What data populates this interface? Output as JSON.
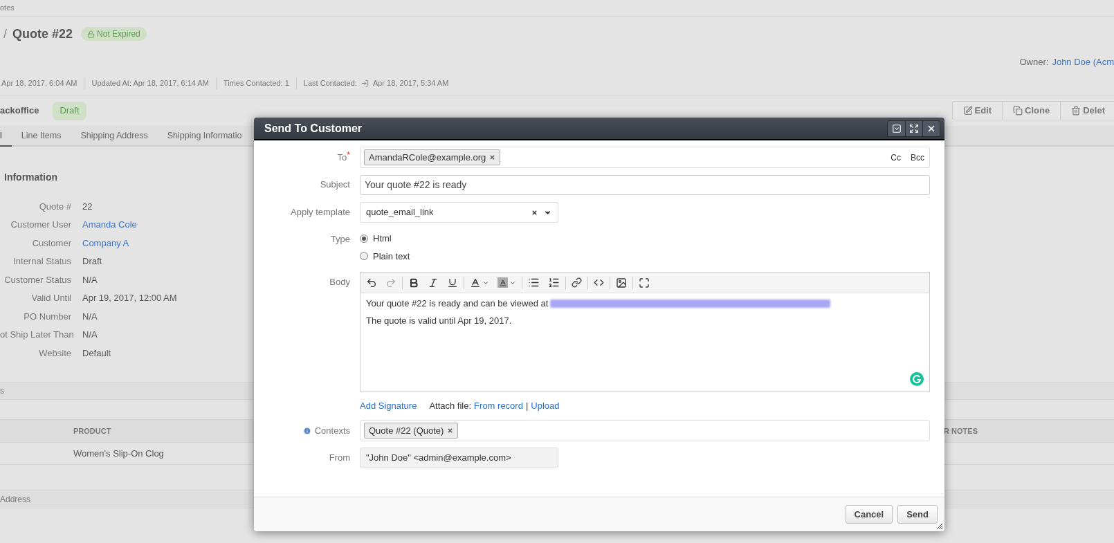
{
  "breadcrumb": "otes",
  "header": {
    "separator": "/",
    "title": "Quote #22",
    "badge": "Not Expired"
  },
  "owner": {
    "label": "Owner:",
    "value": "John Doe (Acm"
  },
  "meta": [
    {
      "kind": "plain",
      "text": "Apr 18, 2017, 6:04 AM"
    },
    {
      "kind": "plain",
      "text": "Updated At: Apr 18, 2017, 6:14 AM"
    },
    {
      "kind": "plain",
      "text": "Times Contacted: 1"
    },
    {
      "kind": "contacted",
      "label": "Last Contacted:",
      "text": "Apr 18, 2017, 5:34 AM"
    }
  ],
  "workflow": {
    "title": "ackoffice",
    "status": "Draft"
  },
  "actions": [
    {
      "kind": "edit",
      "label": "Edit"
    },
    {
      "kind": "clone",
      "label": "Clone"
    },
    {
      "kind": "delete",
      "label": "Delet"
    }
  ],
  "tabs": [
    {
      "label": "l",
      "selected": true
    },
    {
      "label": "Line Items",
      "selected": false
    },
    {
      "label": "Shipping Address",
      "selected": false
    },
    {
      "label": "Shipping Informatio",
      "selected": false
    }
  ],
  "info": {
    "title": "Information",
    "rows": [
      {
        "label": "Quote #",
        "value": "22",
        "link": false
      },
      {
        "label": "Customer User",
        "value": "Amanda Cole",
        "link": true
      },
      {
        "label": "Customer",
        "value": "Company A",
        "link": true
      },
      {
        "label": "Internal Status",
        "value": "Draft",
        "link": false
      },
      {
        "label": "Customer Status",
        "value": "N/A",
        "link": false
      },
      {
        "label": "Valid Until",
        "value": "Apr 19, 2017, 12:00 AM",
        "link": false
      },
      {
        "label": "PO Number",
        "value": "N/A",
        "link": false
      },
      {
        "label": "ot Ship Later Than",
        "value": "N/A",
        "link": false
      },
      {
        "label": "Website",
        "value": "Default",
        "link": false
      }
    ]
  },
  "notes_section": "s",
  "table": {
    "columns": [
      "PRODUCT",
      "R NOTES"
    ],
    "rows": [
      [
        "Women's Slip-On Clog"
      ]
    ]
  },
  "address_section": "Address",
  "dialog": {
    "title": "Send To Customer",
    "to": {
      "label": "To",
      "required_mark": "*",
      "chips": [
        "AmandaRCole@example.org"
      ],
      "cc": "Cc",
      "bcc": "Bcc"
    },
    "subject": {
      "label": "Subject",
      "value": "Your quote #22 is ready"
    },
    "template": {
      "label": "Apply template",
      "value": "quote_email_link"
    },
    "type": {
      "label": "Type",
      "options": [
        {
          "label": "Html",
          "selected": true
        },
        {
          "label": "Plain text",
          "selected": false
        }
      ]
    },
    "body": {
      "label": "Body",
      "lines": [
        "Your quote #22 is ready and can be viewed at",
        "The quote is valid until Apr 19, 2017."
      ]
    },
    "add_signature": "Add Signature",
    "attach_label": "Attach file:",
    "from_record": "From record",
    "attach_separator": "|",
    "upload": "Upload",
    "contexts": {
      "label": "Contexts",
      "chips": [
        "Quote #22 (Quote)"
      ]
    },
    "from": {
      "label": "From",
      "value": "\"John Doe\" <admin@example.com>"
    },
    "buttons": [
      "Cancel",
      "Send"
    ]
  }
}
